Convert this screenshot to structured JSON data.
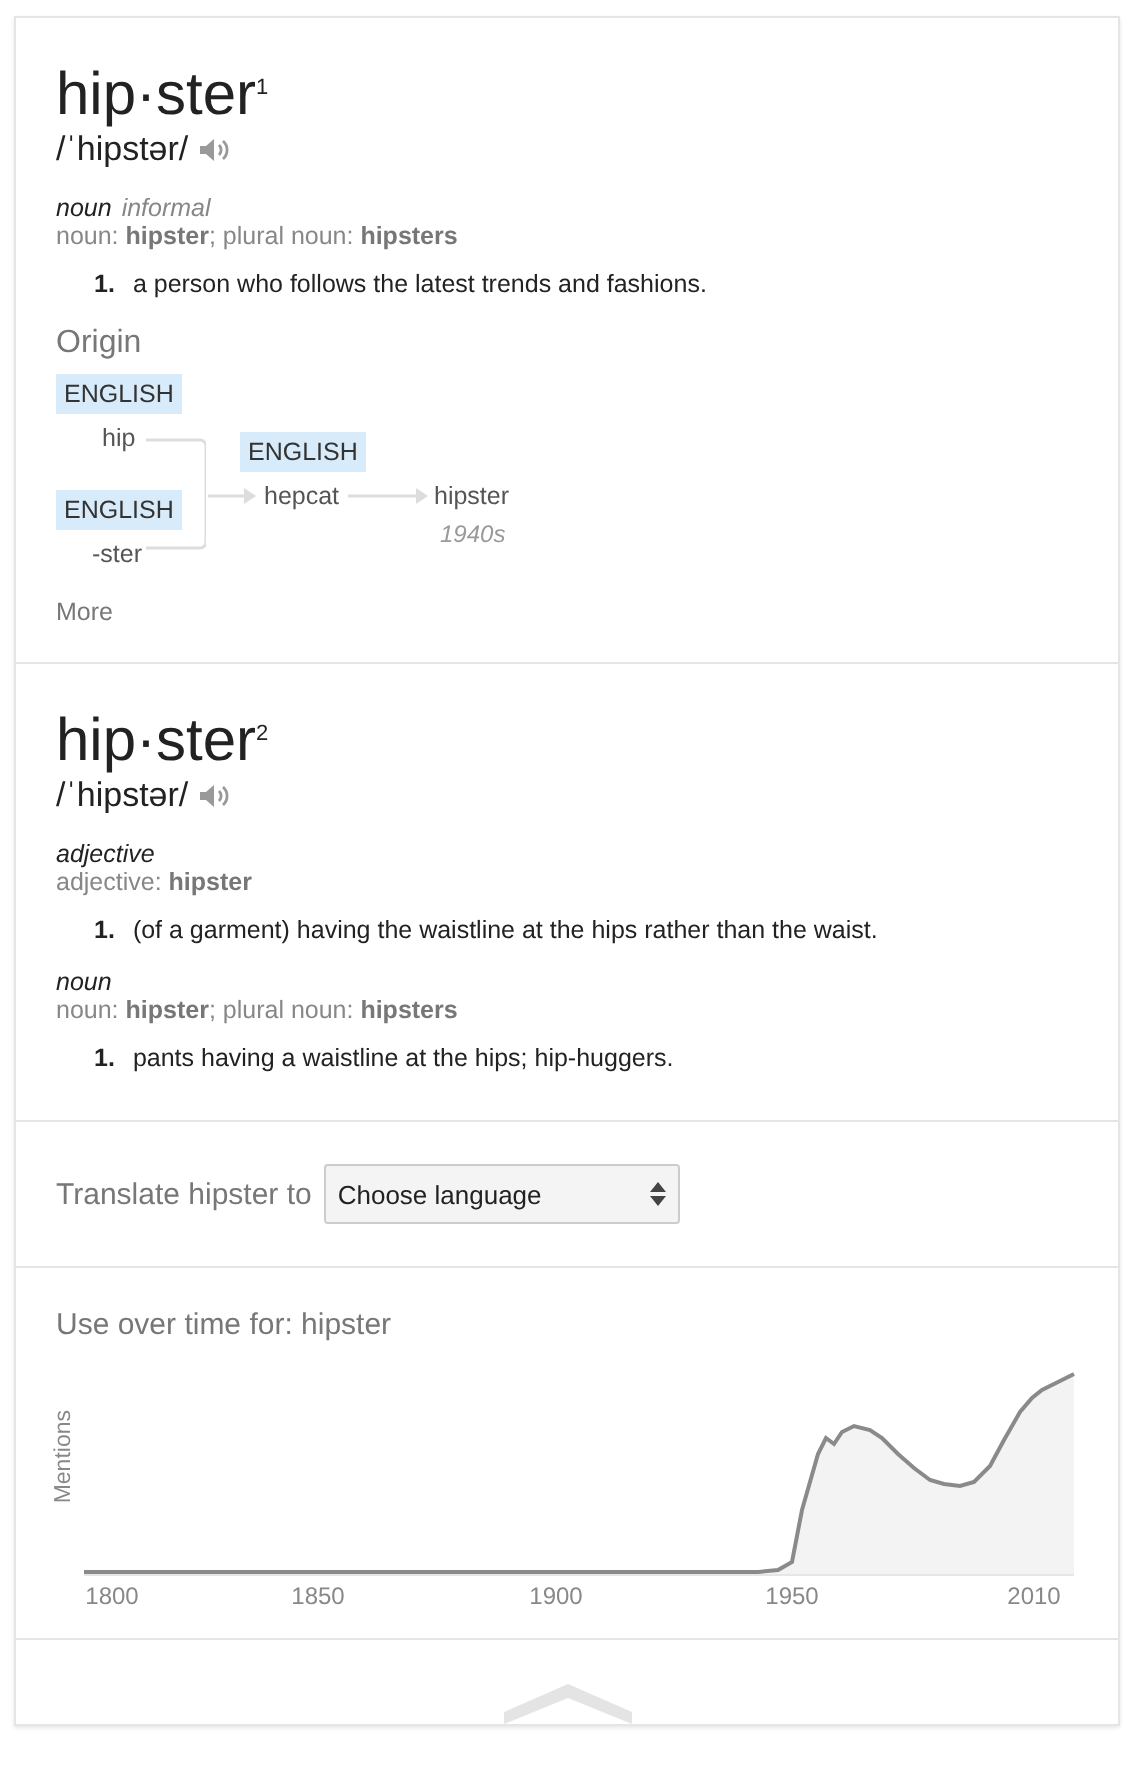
{
  "entries": [
    {
      "headword": "hip·ster",
      "superscript": "1",
      "phonetic": "/ˈhipstər/",
      "groups": [
        {
          "part_of_speech": "noun",
          "register": "informal",
          "forms": "noun: **hipster**; plural noun: **hipsters**",
          "definitions": [
            {
              "number": "1.",
              "text": "a person who follows the latest trends and fashions."
            }
          ]
        }
      ],
      "origin": {
        "title": "Origin",
        "roots": [
          {
            "language": "ENGLISH",
            "word": "hip"
          },
          {
            "language": "ENGLISH",
            "word": "-ster"
          }
        ],
        "intermediate": {
          "language": "ENGLISH",
          "word": "hepcat"
        },
        "result": {
          "word": "hipster",
          "date": "1940s"
        },
        "more": "More"
      }
    },
    {
      "headword": "hip·ster",
      "superscript": "2",
      "phonetic": "/ˈhipstər/",
      "groups": [
        {
          "part_of_speech": "adjective",
          "forms": "adjective: **hipster**",
          "definitions": [
            {
              "number": "1.",
              "text": "(of a garment) having the waistline at the hips rather than the waist."
            }
          ]
        },
        {
          "part_of_speech": "noun",
          "forms": "noun: **hipster**; plural noun: **hipsters**",
          "definitions": [
            {
              "number": "1.",
              "text": "pants having a waistline at the hips; hip-huggers."
            }
          ]
        }
      ]
    }
  ],
  "translate": {
    "label": "Translate hipster to",
    "select": "Choose language"
  },
  "usage": {
    "title": "Use over time for: hipster",
    "ylabel": "Mentions",
    "x_axis_labels": [
      "1800",
      "1850",
      "1900",
      "1950",
      "2010"
    ]
  }
}
